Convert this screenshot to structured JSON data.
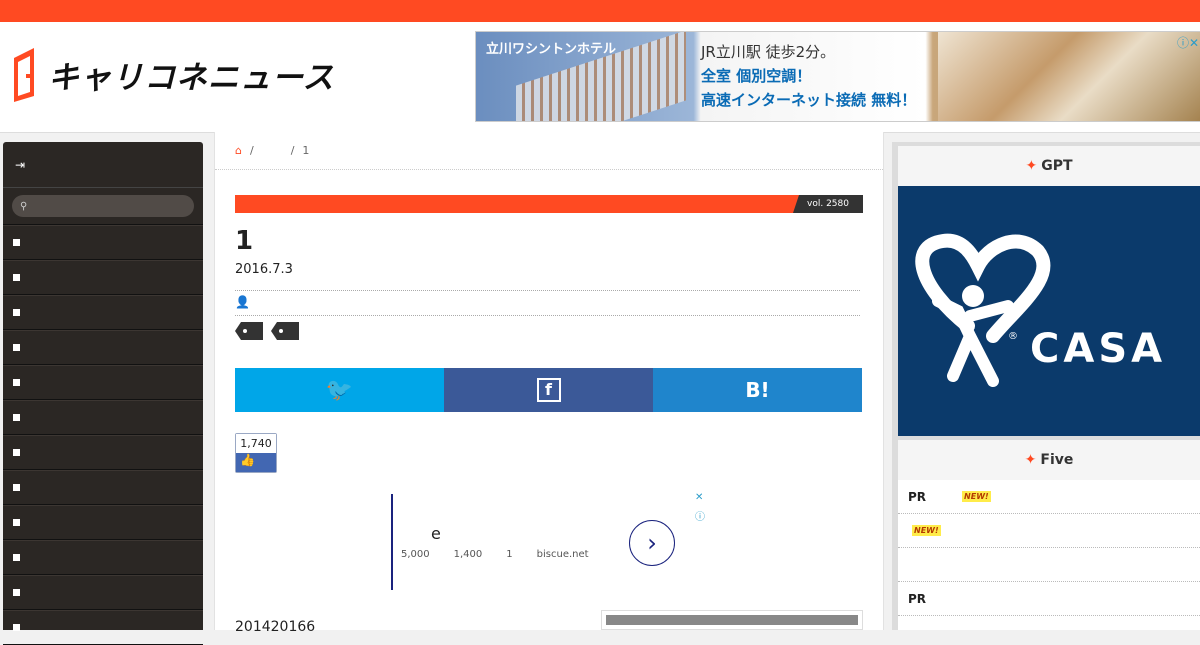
{
  "brand": {
    "logo_text": "キャリコネニュース",
    "accent_color": "#ff4a22"
  },
  "ad_banner": {
    "hotel_name": "立川ワシントンホテル",
    "lines": [
      "JR立川駅 徒歩2分。",
      "全室 個別空調！",
      "高速インターネット接続 無料！"
    ]
  },
  "sidebar": {
    "login_icon": "login-icon",
    "search_icon": "search-icon",
    "items_count_visible": 12
  },
  "breadcrumb": {
    "home_icon": "home-icon",
    "current": "1"
  },
  "article": {
    "vol": "vol. 2580",
    "title": "1",
    "date": "2016.7.3",
    "author_icon": "user-icon",
    "share": {
      "twitter_icon": "twitter-icon",
      "facebook_icon": "facebook-icon",
      "hatena_label": "B!"
    },
    "like_count": "1,740",
    "intro": "201420166"
  },
  "inline_ad": {
    "letter": "e",
    "meta": [
      "5,000",
      "1,400",
      "1",
      "biscue.net"
    ]
  },
  "right": {
    "gpt_title": "GPT",
    "casa_text": "CASA",
    "five_title": "Five",
    "rows": [
      {
        "label": "PR",
        "badge": "NEW!"
      },
      {
        "label": "",
        "badge": "NEW!"
      },
      {
        "label": "",
        "badge": ""
      },
      {
        "label": "PR",
        "badge": ""
      }
    ]
  }
}
